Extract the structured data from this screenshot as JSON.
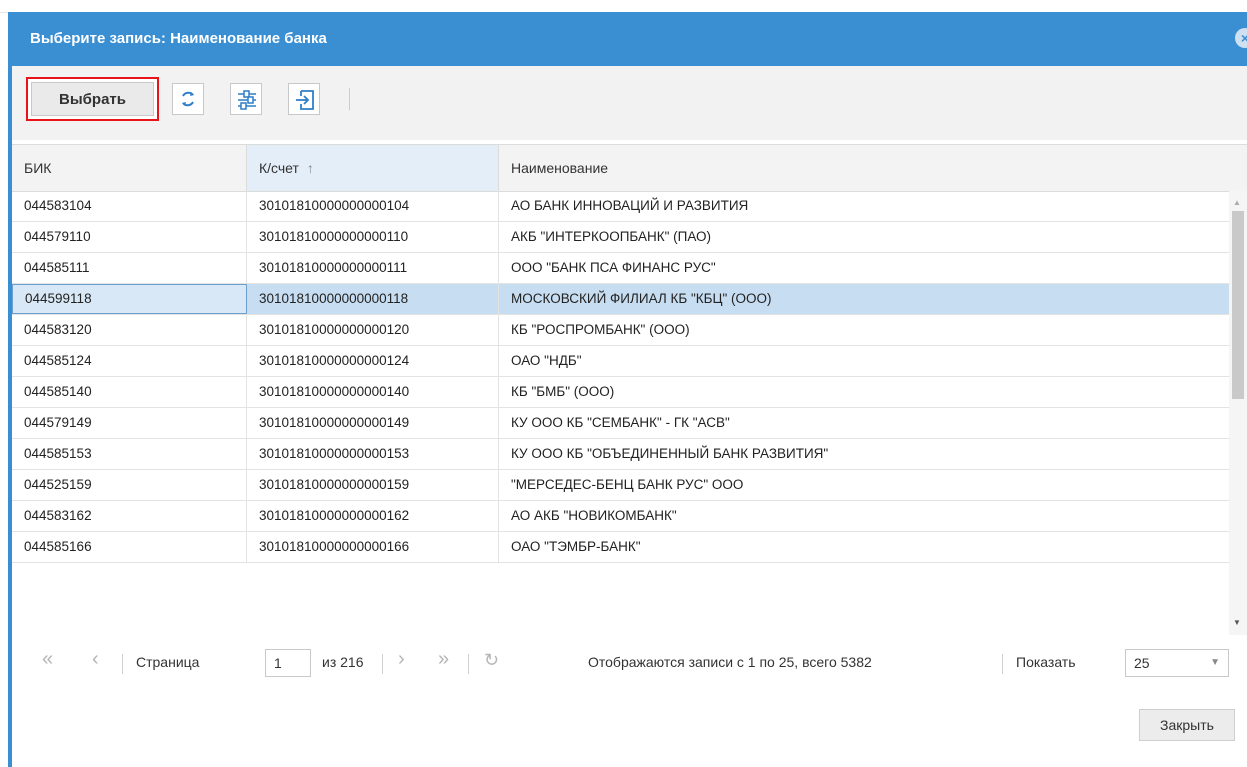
{
  "dialog": {
    "title": "Выберите запись: Наименование банка",
    "close_icon": "close-circle-icon"
  },
  "toolbar": {
    "select_label": "Выбрать",
    "icons": [
      "refresh-icon",
      "filter-settings-icon",
      "export-icon"
    ]
  },
  "table": {
    "columns": [
      "БИК",
      "К/счет",
      "Наименование"
    ],
    "sort_indicator": "↑",
    "rows": [
      {
        "bik": "044583104",
        "account": "30101810000000000104",
        "name": "АО БАНК ИННОВАЦИЙ И РАЗВИТИЯ"
      },
      {
        "bik": "044579110",
        "account": "30101810000000000110",
        "name": "АКБ \"ИНТЕРКООПБАНК\" (ПАО)"
      },
      {
        "bik": "044585111",
        "account": "30101810000000000111",
        "name": "ООО \"БАНК ПСА ФИНАНС РУС\""
      },
      {
        "bik": "044599118",
        "account": "30101810000000000118",
        "name": "МОСКОВСКИЙ ФИЛИАЛ КБ \"КБЦ\" (ООО)"
      },
      {
        "bik": "044583120",
        "account": "30101810000000000120",
        "name": "КБ \"РОСПРОМБАНК\" (ООО)"
      },
      {
        "bik": "044585124",
        "account": "30101810000000000124",
        "name": "ОАО \"НДБ\""
      },
      {
        "bik": "044585140",
        "account": "30101810000000000140",
        "name": "КБ \"БМБ\" (ООО)"
      },
      {
        "bik": "044579149",
        "account": "30101810000000000149",
        "name": "КУ ООО КБ \"СЕМБАНК\" - ГК \"АСВ\""
      },
      {
        "bik": "044585153",
        "account": "30101810000000000153",
        "name": "КУ ООО КБ \"ОБЪЕДИНЕННЫЙ БАНК РАЗВИТИЯ\""
      },
      {
        "bik": "044525159",
        "account": "30101810000000000159",
        "name": "\"МЕРСЕДЕС-БЕНЦ БАНК РУС\" ООО"
      },
      {
        "bik": "044583162",
        "account": "30101810000000000162",
        "name": "АО АКБ \"НОВИКОМБАНК\""
      },
      {
        "bik": "044585166",
        "account": "30101810000000000166",
        "name": "ОАО \"ТЭМБР-БАНК\""
      }
    ],
    "selected_row": 3
  },
  "pager": {
    "page_label": "Страница",
    "page_value": "1",
    "of_label": "из 216",
    "records_label": "Отображаются записи с 1 по 25, всего 5382",
    "show_label": "Показать",
    "page_size": "25"
  },
  "footer": {
    "close_label": "Закрыть"
  },
  "colors": {
    "accent": "#3a8fd3",
    "selected_row": "#c7ddf2",
    "highlight_border": "#e8141a"
  }
}
